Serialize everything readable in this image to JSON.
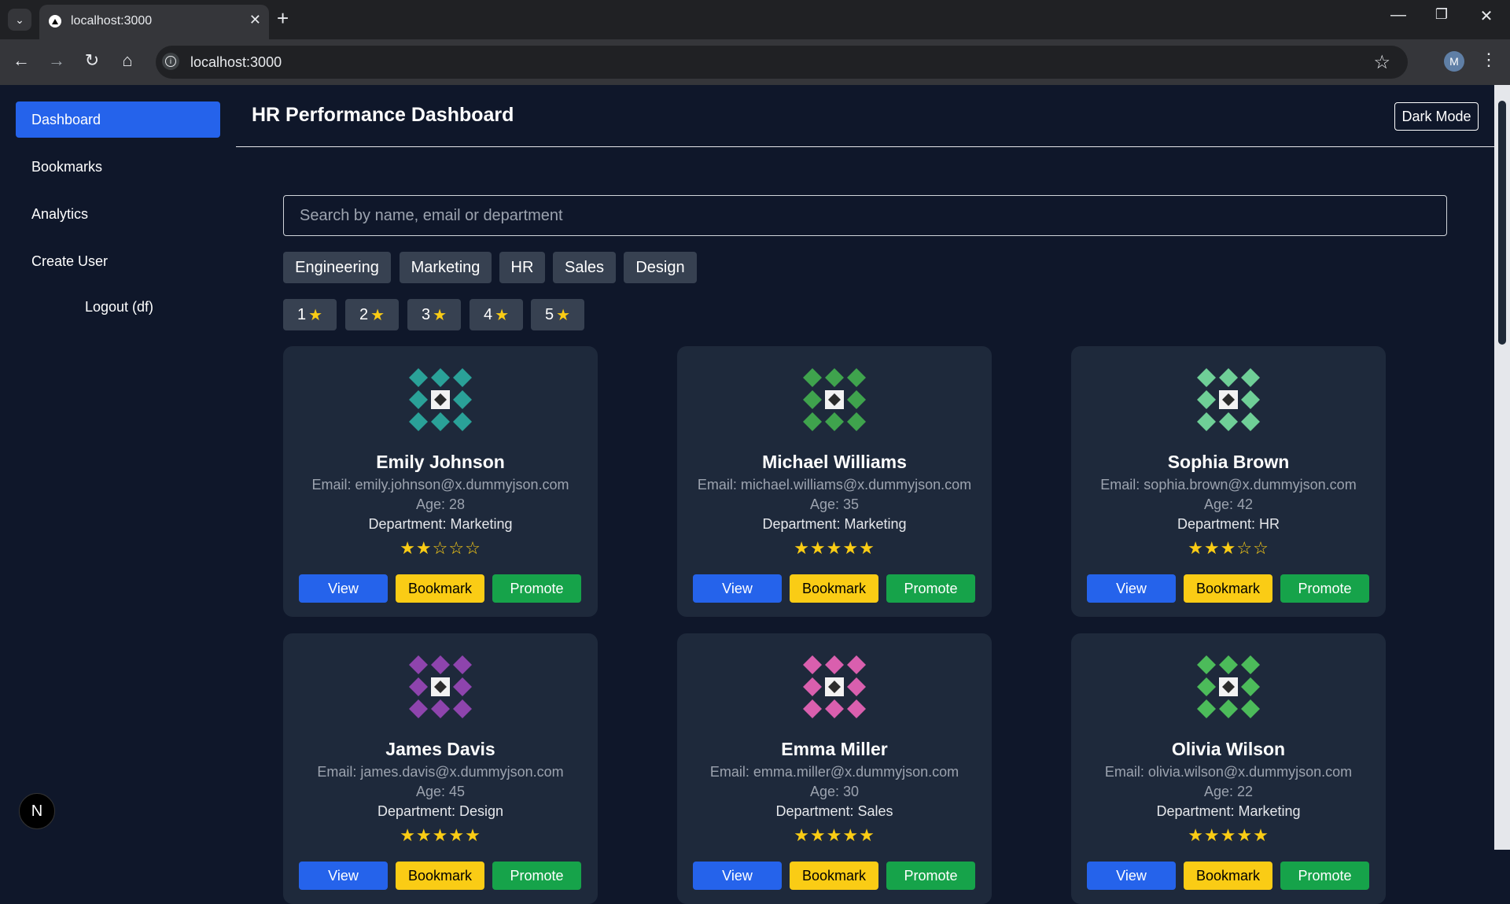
{
  "browser": {
    "tab_title": "localhost:3000",
    "url": "localhost:3000",
    "profile_initial": "M"
  },
  "sidebar": {
    "items": [
      {
        "label": "Dashboard",
        "active": true
      },
      {
        "label": "Bookmarks"
      },
      {
        "label": "Analytics"
      },
      {
        "label": "Create User"
      }
    ],
    "logout_label": "Logout (df)",
    "badge": "N"
  },
  "header": {
    "title": "HR Performance Dashboard",
    "dark_mode_label": "Dark Mode"
  },
  "search": {
    "placeholder": "Search by name, email or department"
  },
  "department_filters": [
    "Engineering",
    "Marketing",
    "HR",
    "Sales",
    "Design"
  ],
  "rating_filters": [
    "1",
    "2",
    "3",
    "4",
    "5"
  ],
  "cards": [
    {
      "name": "Emily Johnson",
      "email": "Email: emily.johnson@x.dummyjson.com",
      "age": "Age: 28",
      "department": "Department: Marketing",
      "rating": 2,
      "stars": "★★☆☆☆",
      "icon_color": "#2aa198"
    },
    {
      "name": "Michael Williams",
      "email": "Email: michael.williams@x.dummyjson.com",
      "age": "Age: 35",
      "department": "Department: Marketing",
      "rating": 5,
      "stars": "★★★★★",
      "icon_color": "#3fa34d"
    },
    {
      "name": "Sophia Brown",
      "email": "Email: sophia.brown@x.dummyjson.com",
      "age": "Age: 42",
      "department": "Department: HR",
      "rating": 3,
      "stars": "★★★☆☆",
      "icon_color": "#6fcf97"
    },
    {
      "name": "James Davis",
      "email": "Email: james.davis@x.dummyjson.com",
      "age": "Age: 45",
      "department": "Department: Design",
      "rating": 5,
      "stars": "★★★★★",
      "icon_color": "#8e44ad"
    },
    {
      "name": "Emma Miller",
      "email": "Email: emma.miller@x.dummyjson.com",
      "age": "Age: 30",
      "department": "Department: Sales",
      "rating": 5,
      "stars": "★★★★★",
      "icon_color": "#d95fae"
    },
    {
      "name": "Olivia Wilson",
      "email": "Email: olivia.wilson@x.dummyjson.com",
      "age": "Age: 22",
      "department": "Department: Marketing",
      "rating": 5,
      "stars": "★★★★★",
      "icon_color": "#4cbb5a"
    }
  ],
  "card_buttons": {
    "view": "View",
    "bookmark": "Bookmark",
    "promote": "Promote"
  },
  "colors": {
    "primary": "#2563eb",
    "bookmark": "#facc15",
    "promote": "#16a34a",
    "background": "#0f172a",
    "card": "#1e293b"
  }
}
